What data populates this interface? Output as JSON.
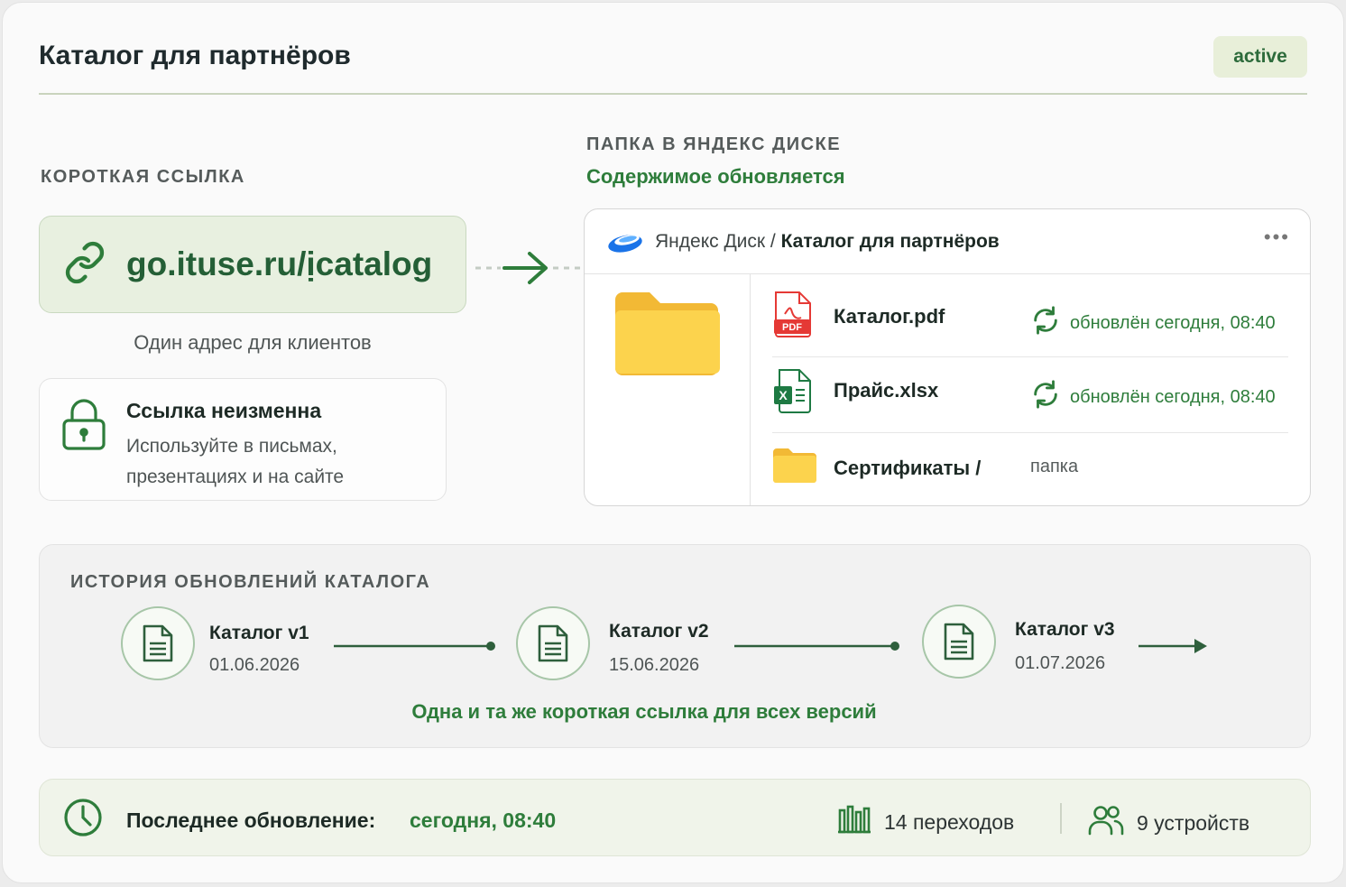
{
  "header": {
    "title": "Каталог для партнёров",
    "status_badge": "active"
  },
  "short_link": {
    "section_label": "КОРОТКАЯ ССЫЛКА",
    "url": "go.ituse.ru/ịcatalog",
    "description": "Один адрес для клиентов",
    "lock_title": "Ссылка неизменна",
    "lock_text_line1": "Используйте в письмах,",
    "lock_text_line2": "презентациях и на сайте"
  },
  "disk": {
    "section_label": "ПАПКА В ЯНДЕКС ДИСКЕ",
    "subtitle": "Содержимое обновляется",
    "path_root": "Яндекс Диск /",
    "path_folder": "Каталог для партнёров",
    "more_menu": "•••",
    "files": [
      {
        "name": "Каталог.pdf",
        "icon": "pdf-icon",
        "status": "обновлён сегодня, 08:40"
      },
      {
        "name": "Прайс.xlsx",
        "icon": "xlsx-icon",
        "status": "обновлён сегодня, 08:40"
      },
      {
        "name": "Сертификаты /",
        "icon": "folder-icon",
        "kind": "папка"
      }
    ]
  },
  "history": {
    "section_label": "ИСТОРИЯ ОБНОВЛЕНИЙ КАТАЛОГА",
    "versions": [
      {
        "name": "Каталог v1",
        "date": "01.06.2026"
      },
      {
        "name": "Каталог v2",
        "date": "15.06.2026"
      },
      {
        "name": "Каталог v3",
        "date": "01.07.2026"
      }
    ],
    "caption": "Одна и та же короткая ссылка для всех версий"
  },
  "footer": {
    "last_update_label": "Последнее обновление:",
    "last_update_value": "сегодня, 08:40",
    "clicks": "14 переходов",
    "devices": "9 устройств"
  },
  "colors": {
    "accent_green": "#2e7d3b",
    "dark_green": "#245f36",
    "folder_yellow": "#fcd34d",
    "pdf_red": "#e53935",
    "excel_green": "#1e7a43",
    "disk_blue": "#1a73e8"
  }
}
